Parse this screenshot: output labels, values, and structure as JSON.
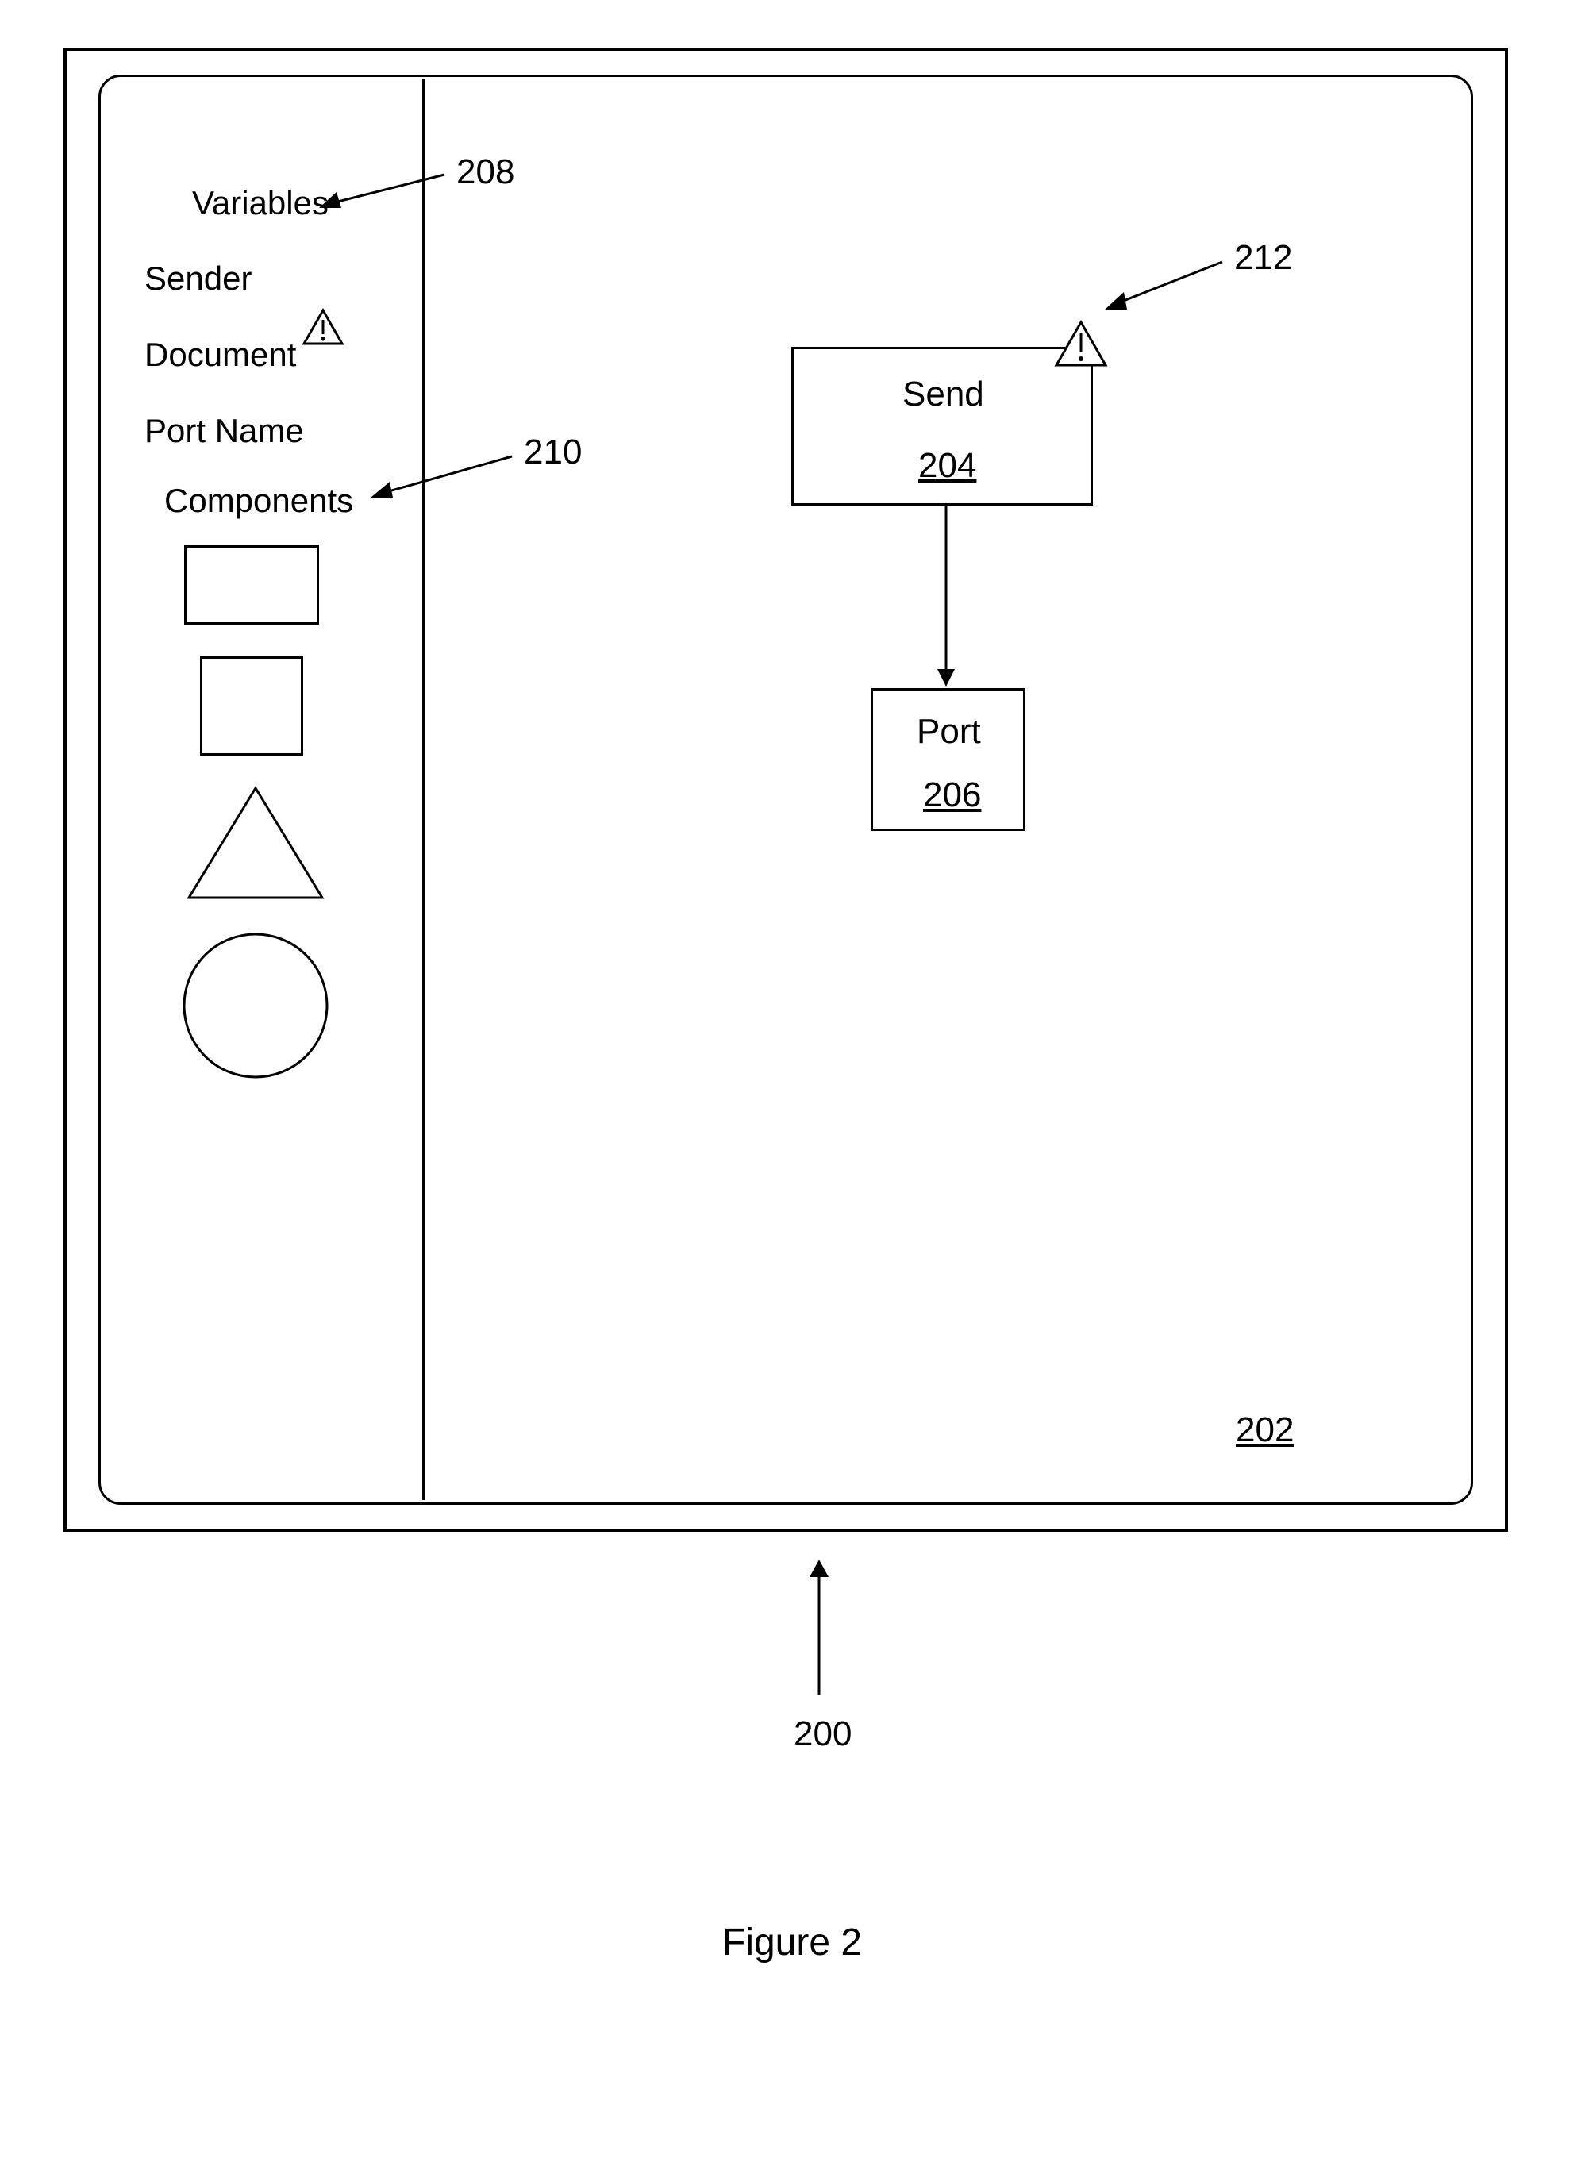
{
  "sidebar": {
    "variables_header": "Variables",
    "items": [
      "Sender",
      "Document",
      "Port Name"
    ],
    "components_header": "Components"
  },
  "canvas": {
    "send": {
      "label": "Send",
      "ref": "204"
    },
    "port": {
      "label": "Port",
      "ref": "206"
    },
    "canvas_ref": "202"
  },
  "callouts": {
    "variables": "208",
    "components": "210",
    "send_warning": "212",
    "figure_window": "200"
  },
  "caption": "Figure 2"
}
